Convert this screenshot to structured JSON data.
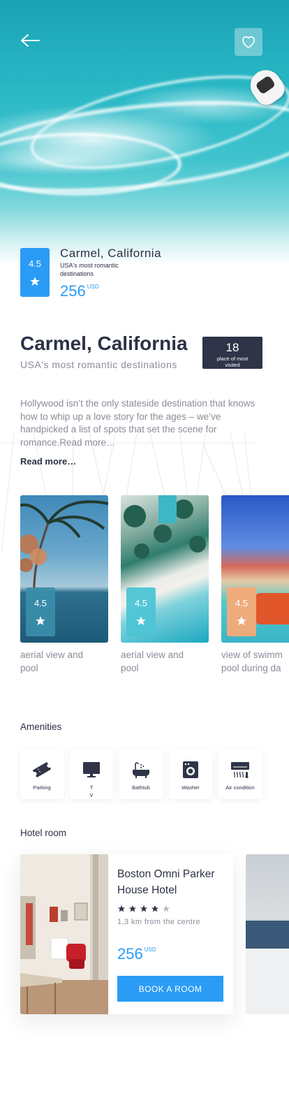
{
  "header": {
    "back_icon": "arrow-left-icon",
    "favorite_icon": "heart-icon"
  },
  "summary": {
    "rating": "4.5",
    "title": "Carmel, California",
    "subtitle": "USA's most romantic destinations",
    "price": "256",
    "currency": "USD"
  },
  "detail": {
    "title": "Carmel, California",
    "subtitle": "USA's most romantic destinations",
    "rank_number": "18",
    "rank_label": "place of most visited",
    "description": "Hollywood isn’t the only stateside destination that knows how to whip up a love story for the ages – we’ve handpicked a list of spots that set the scene for romance.Read more…",
    "read_more": "Read more…"
  },
  "gallery": [
    {
      "rating": "4.5",
      "caption": "aerial view   and pool",
      "accent": "#3a8eaa"
    },
    {
      "rating": "4.5",
      "caption": "aerial view   and pool",
      "accent": "#4dc4d4"
    },
    {
      "rating": "4.5",
      "caption": "view of swimming pool during day",
      "accent": "#f7aa78"
    }
  ],
  "amenities": {
    "title": "Amenities",
    "items": [
      {
        "label": "Parking",
        "icon": "ticket-icon"
      },
      {
        "label": "TV",
        "icon": "tv-icon"
      },
      {
        "label": "Bathtub",
        "icon": "bathtub-icon"
      },
      {
        "label": "Washer",
        "icon": "washer-icon"
      },
      {
        "label": "Air condition",
        "icon": "air-condition-icon"
      }
    ]
  },
  "hotel": {
    "section_title": "Hotel room",
    "name": "Boston Omni Parker House Hotel",
    "stars_filled": 4,
    "stars_total": 5,
    "distance": "1,3 km from the centre",
    "price": "256",
    "currency": "USD",
    "book_label": "BOOK A ROOM"
  },
  "colors": {
    "accent": "#2b9cf5",
    "dark": "#2f3448",
    "muted": "#8a8d99"
  }
}
